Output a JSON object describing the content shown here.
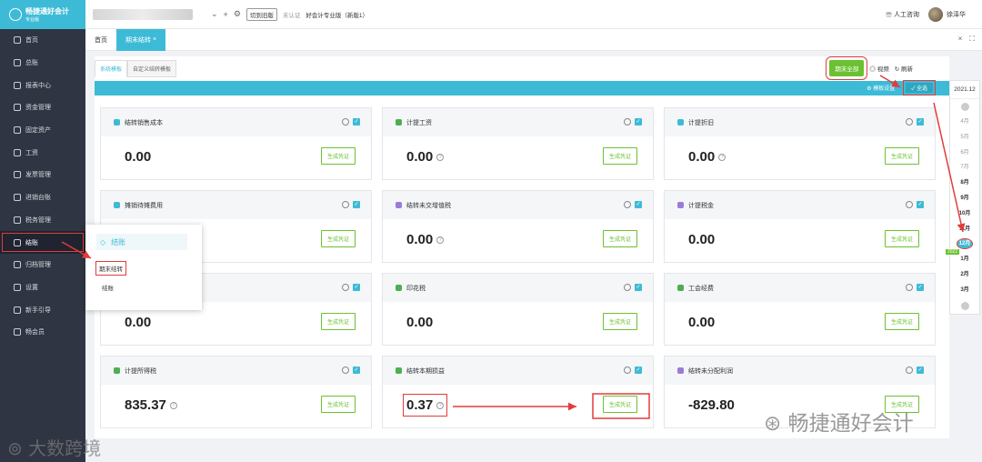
{
  "brand": {
    "name": "畅捷通好会计",
    "edition": "专业版"
  },
  "sidebar": {
    "items": [
      {
        "label": "首页",
        "icon": "home-icon"
      },
      {
        "label": "总账",
        "icon": "ledger-icon"
      },
      {
        "label": "报表中心",
        "icon": "report-icon"
      },
      {
        "label": "资金管理",
        "icon": "fund-icon"
      },
      {
        "label": "固定资产",
        "icon": "asset-icon"
      },
      {
        "label": "工资",
        "icon": "salary-icon"
      },
      {
        "label": "发票管理",
        "icon": "invoice-icon"
      },
      {
        "label": "进销台账",
        "icon": "inventory-icon"
      },
      {
        "label": "税务管理",
        "icon": "tax-icon"
      },
      {
        "label": "结账",
        "icon": "closing-icon"
      },
      {
        "label": "归档管理",
        "icon": "archive-icon"
      },
      {
        "label": "设置",
        "icon": "settings-icon"
      },
      {
        "label": "新手引导",
        "icon": "guide-icon"
      },
      {
        "label": "畅会员",
        "icon": "vip-icon"
      }
    ]
  },
  "topbar": {
    "switch_label": "切到旧版",
    "unverified": "未认证",
    "edition": "好会计专业版（新版1）",
    "support": "人工咨询",
    "user": "徐泽华"
  },
  "tabs": {
    "home": "首页",
    "active": "期末结转"
  },
  "subtabs": {
    "system": "系统模板",
    "custom": "自定义结转模板"
  },
  "toolbar": {
    "generate_all": "期末全部",
    "video": "视频",
    "refresh": "刷新",
    "select_all": "全选",
    "template": "模板设置"
  },
  "cards": [
    {
      "title": "结转销售成本",
      "amount": "0.00",
      "button": "生成凭证",
      "help": false
    },
    {
      "title": "计提工资",
      "amount": "0.00",
      "button": "生成凭证",
      "help": true
    },
    {
      "title": "计提折旧",
      "amount": "0.00",
      "button": "生成凭证",
      "help": true
    },
    {
      "title": "摊销待摊费用",
      "amount": "0.00",
      "button": "生成凭证",
      "help": false
    },
    {
      "title": "结转未交增值税",
      "amount": "0.00",
      "button": "生成凭证",
      "help": true
    },
    {
      "title": "计提税金",
      "amount": "0.00",
      "button": "生成凭证",
      "help": false
    },
    {
      "title": "",
      "amount": "0.00",
      "button": "生成凭证",
      "help": false
    },
    {
      "title": "印花税",
      "amount": "0.00",
      "button": "生成凭证",
      "help": false
    },
    {
      "title": "工会经费",
      "amount": "0.00",
      "button": "生成凭证",
      "help": false
    },
    {
      "title": "计提所得税",
      "amount": "835.37",
      "button": "生成凭证",
      "help": true
    },
    {
      "title": "结转本期损益",
      "amount": "0.37",
      "button": "生成凭证",
      "help": true
    },
    {
      "title": "结转未分配利润",
      "amount": "-829.80",
      "button": "生成凭证",
      "help": false
    }
  ],
  "popup": {
    "title": "结账",
    "item1": "期末结转",
    "item2": "结账"
  },
  "months": {
    "year": "2021.12",
    "list": [
      "4月",
      "5月",
      "6月",
      "7月",
      "8月",
      "9月",
      "10月",
      "11月",
      "12月",
      "1月",
      "2月",
      "3月"
    ],
    "badge": "2022"
  },
  "watermarks": {
    "left": "大数跨境",
    "right": "畅捷通好会计"
  },
  "colors": {
    "accent": "#3dbbd6",
    "green": "#6cc132",
    "annotation": "#e23c3c",
    "sidebar": "#2f3542"
  }
}
